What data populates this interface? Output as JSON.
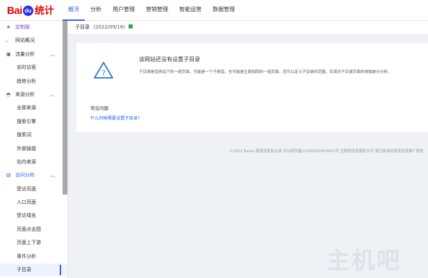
{
  "logo": {
    "bai": "Bai",
    "paw": "du",
    "tongji": "统计"
  },
  "topnav": [
    "概况",
    "分析",
    "用户管理",
    "营销管理",
    "智能运营",
    "数据管理"
  ],
  "sidebar": {
    "custom": "定制版",
    "overview": "网站概况",
    "traffic": {
      "label": "流量分析",
      "items": [
        "实时访客",
        "趋势分析"
      ]
    },
    "source": {
      "label": "来源分析",
      "items": [
        "全部来源",
        "搜索引擎",
        "搜索词",
        "外部链接",
        "站内来源"
      ]
    },
    "visit": {
      "label": "访问分析",
      "items": [
        "受访页面",
        "入口页面",
        "受访域名",
        "页面点击图",
        "页面上下游",
        "事件分析",
        "子目录"
      ]
    }
  },
  "subheader": {
    "title": "子目录",
    "date": "(2022/09/16)"
  },
  "card": {
    "title": "该网站还没有设置子目录",
    "desc": "子目录是您网站下的一组页面，可能是一个子频道，也可能是主题相同的一组页面。您可以定义子目录的范围，实现对子目录页面的单独统计分析。",
    "faq_title": "常见问题",
    "faq_link": "什么时候需要设置子目录?"
  },
  "footer": "©2022 Baidu 使用百度前必读 京公网安备11000002000001号 互联网信息服务许可 我已阅读并接受百度推广服务",
  "watermark": "主机吧",
  "colors": {
    "accent": "#2c64e8",
    "brand_red": "#e10601",
    "custom_purple": "#7b4fd6"
  }
}
